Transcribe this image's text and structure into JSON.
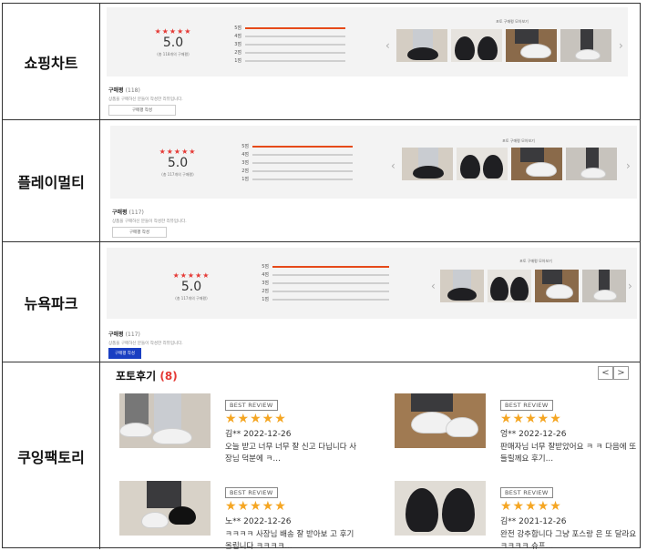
{
  "rows": [
    {
      "label": "쇼핑차트",
      "rating_score": "5.0",
      "rating_count_text": "(총 118개의 구매평)",
      "distribution": [
        {
          "label": "5점",
          "fraction": 1.0
        },
        {
          "label": "4점",
          "fraction": 0
        },
        {
          "label": "3점",
          "fraction": 0
        },
        {
          "label": "2점",
          "fraction": 0
        },
        {
          "label": "1점",
          "fraction": 0
        }
      ],
      "photo_section_title": "포토 구매평 모아보기",
      "reviews_label": "구매평",
      "reviews_count": "(118)",
      "reviews_desc": "상품을 구매하신 분들이 작성한 리뷰입니다.",
      "write_button": "구매평 작성"
    },
    {
      "label": "플레이멀티",
      "rating_score": "5.0",
      "rating_count_text": "(총 117개의 구매평)",
      "distribution": [
        {
          "label": "5점",
          "fraction": 1.0
        },
        {
          "label": "4점",
          "fraction": 0
        },
        {
          "label": "3점",
          "fraction": 0
        },
        {
          "label": "2점",
          "fraction": 0
        },
        {
          "label": "1점",
          "fraction": 0
        }
      ],
      "photo_section_title": "포토 구매평 모아보기",
      "reviews_label": "구매평",
      "reviews_count": "(117)",
      "reviews_desc": "상품을 구매하신 분들이 작성한 리뷰입니다.",
      "write_button": "구매평 작성"
    },
    {
      "label": "뉴욕파크",
      "rating_score": "5.0",
      "rating_count_text": "(총 117개의 구매평)",
      "distribution": [
        {
          "label": "5점",
          "fraction": 1.0
        },
        {
          "label": "4점",
          "fraction": 0
        },
        {
          "label": "3점",
          "fraction": 0
        },
        {
          "label": "2점",
          "fraction": 0
        },
        {
          "label": "1점",
          "fraction": 0
        }
      ],
      "photo_section_title": "포토 구매평 모아보기",
      "reviews_label": "구매평",
      "reviews_count": "(117)",
      "reviews_desc": "상품을 구매하신 분들이 작성한 리뷰입니다.",
      "write_button": "구매평 작성"
    }
  ],
  "photo_reviews": {
    "label": "쿠잉팩토리",
    "title": "포토후기",
    "count": "(8)",
    "prev": "<",
    "next": ">",
    "cards": [
      {
        "badge": "BEST REVIEW",
        "rating": 5,
        "author_date": "김** 2022-12-26",
        "text": "오늘 받고 너무 너무 잘 신고 다닙니다 사장님 덕분에 ㅋ…"
      },
      {
        "badge": "BEST REVIEW",
        "rating": 5,
        "author_date": "엉** 2022-12-26",
        "text": "판매자님 너무 잘받았어요 ㅋ ㅋ 다음에 또 들릴께요 후기…"
      },
      {
        "badge": "BEST REVIEW",
        "rating": 5,
        "author_date": "노** 2022-12-26",
        "text": "ㅋㅋㅋㅋ 사장님 배송 잘 받아보 고 후기 올립니다 ㅋㅋㅋㅋ…"
      },
      {
        "badge": "BEST REVIEW",
        "rating": 5,
        "author_date": "김** 2021-12-26",
        "text": "완전 강추합니다 그냥 포스랑 은 또 달라요 ㅋㅋㅋㅋ 슈프…"
      }
    ]
  },
  "colors": {
    "accent_red": "#e53935",
    "star_orange": "#f5a623",
    "write_blue": "#1a3fc2"
  }
}
